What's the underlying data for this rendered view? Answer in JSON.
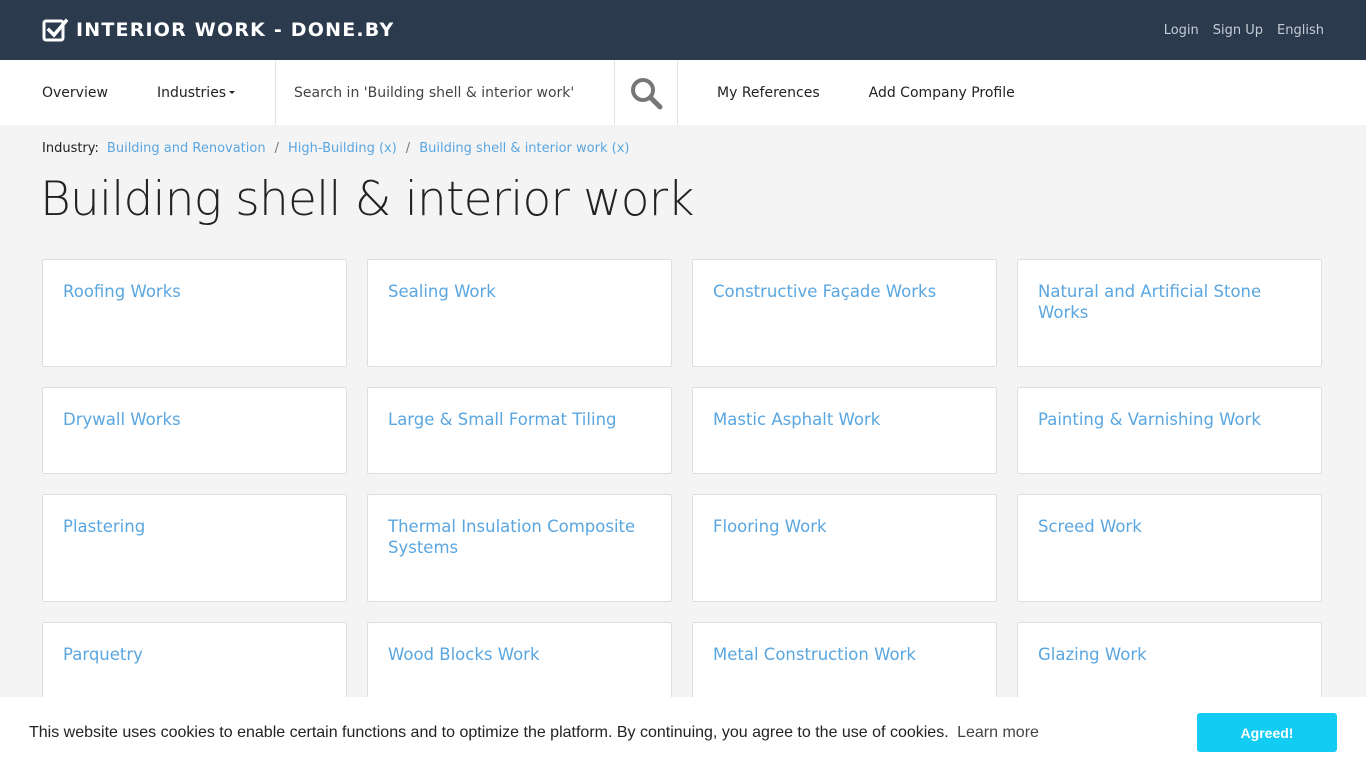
{
  "header": {
    "logo_text": "INTERIOR WORK - DONE.BY",
    "links": [
      "Login",
      "Sign Up",
      "English"
    ]
  },
  "nav": {
    "overview": "Overview",
    "industries": "Industries",
    "search_placeholder": "Search in 'Building shell & interior work'",
    "my_references": "My References",
    "add_company": "Add Company Profile"
  },
  "breadcrumb": {
    "label": "Industry:",
    "items": [
      "Building and Renovation",
      "High-Building (x)",
      "Building shell & interior work (x)"
    ],
    "separator": "/"
  },
  "page_title": "Building shell & interior work",
  "categories": [
    "Roofing Works",
    "Sealing Work",
    "Constructive Façade Works",
    "Natural and Artificial Stone Works",
    "Drywall Works",
    "Large & Small Format Tiling",
    "Mastic Asphalt Work",
    "Painting & Varnishing Work",
    "Plastering",
    "Thermal Insulation Composite Systems",
    "Flooring Work",
    "Screed Work",
    "Parquetry",
    "Wood Blocks Work",
    "Metal Construction Work",
    "Glazing Work"
  ],
  "cookie": {
    "text": "This website uses cookies to enable certain functions and to optimize the platform. By continuing, you agree to the use of cookies.",
    "learn_more": "Learn more",
    "agree": "Agreed!"
  },
  "colors": {
    "header_bg": "#2c3a4e",
    "link": "#5aa6e0",
    "agree_btn": "#12ccf3"
  }
}
